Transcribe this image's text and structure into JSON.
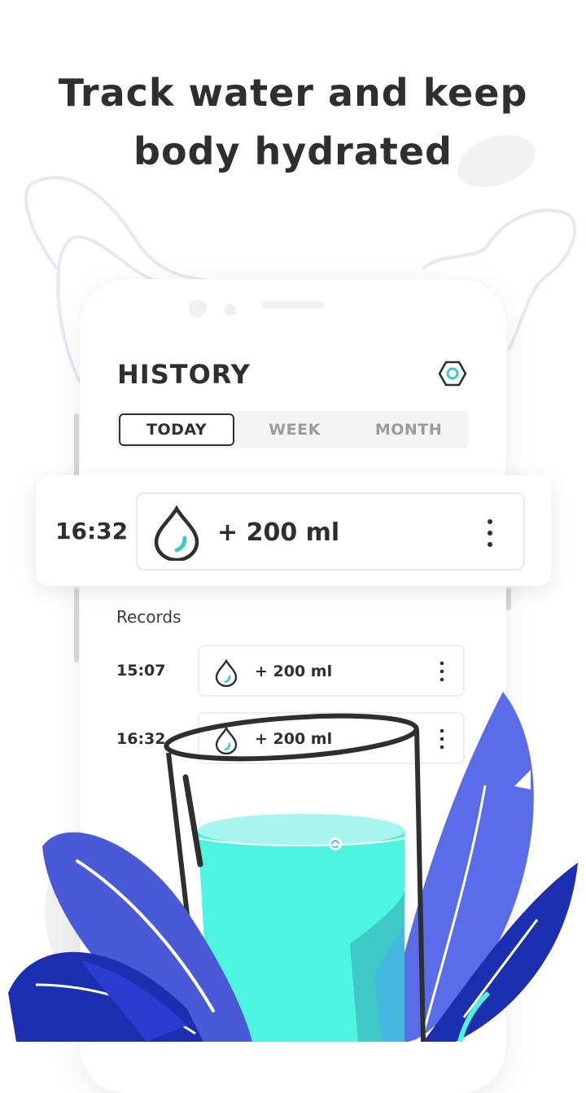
{
  "headline": {
    "line1": "Track water and keep",
    "line2": "body hydrated"
  },
  "screen": {
    "title": "HISTORY",
    "settings_icon": "hexagon-settings-icon",
    "tabs": [
      {
        "label": "TODAY",
        "active": true
      },
      {
        "label": "WEEK",
        "active": false
      },
      {
        "label": "MONTH",
        "active": false
      }
    ],
    "highlight": {
      "time": "16:32",
      "amount": "+ 200 ml"
    },
    "records_label": "Records",
    "records": [
      {
        "time": "15:07",
        "amount": "+ 200 ml"
      },
      {
        "time": "16:32",
        "amount": "+ 200 ml"
      }
    ]
  },
  "colors": {
    "water": "#4df5e0",
    "water_dark": "#3ec8c6",
    "leaf_blue": "#5b6ce8",
    "leaf_dark": "#1b2fb0",
    "outline_blob": "#e6e8f6",
    "text": "#2f2f2f"
  }
}
